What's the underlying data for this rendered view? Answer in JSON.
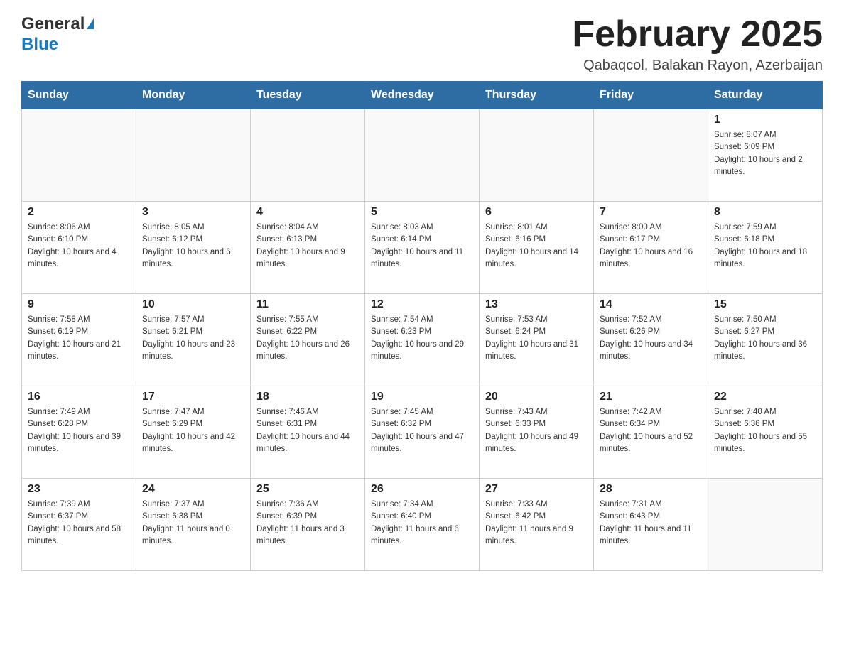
{
  "header": {
    "logo_general": "General",
    "logo_arrow": "▶",
    "logo_blue": "Blue",
    "month_title": "February 2025",
    "location": "Qabaqcol, Balakan Rayon, Azerbaijan"
  },
  "weekdays": [
    "Sunday",
    "Monday",
    "Tuesday",
    "Wednesday",
    "Thursday",
    "Friday",
    "Saturday"
  ],
  "weeks": [
    [
      {
        "day": "",
        "info": ""
      },
      {
        "day": "",
        "info": ""
      },
      {
        "day": "",
        "info": ""
      },
      {
        "day": "",
        "info": ""
      },
      {
        "day": "",
        "info": ""
      },
      {
        "day": "",
        "info": ""
      },
      {
        "day": "1",
        "info": "Sunrise: 8:07 AM\nSunset: 6:09 PM\nDaylight: 10 hours and 2 minutes."
      }
    ],
    [
      {
        "day": "2",
        "info": "Sunrise: 8:06 AM\nSunset: 6:10 PM\nDaylight: 10 hours and 4 minutes."
      },
      {
        "day": "3",
        "info": "Sunrise: 8:05 AM\nSunset: 6:12 PM\nDaylight: 10 hours and 6 minutes."
      },
      {
        "day": "4",
        "info": "Sunrise: 8:04 AM\nSunset: 6:13 PM\nDaylight: 10 hours and 9 minutes."
      },
      {
        "day": "5",
        "info": "Sunrise: 8:03 AM\nSunset: 6:14 PM\nDaylight: 10 hours and 11 minutes."
      },
      {
        "day": "6",
        "info": "Sunrise: 8:01 AM\nSunset: 6:16 PM\nDaylight: 10 hours and 14 minutes."
      },
      {
        "day": "7",
        "info": "Sunrise: 8:00 AM\nSunset: 6:17 PM\nDaylight: 10 hours and 16 minutes."
      },
      {
        "day": "8",
        "info": "Sunrise: 7:59 AM\nSunset: 6:18 PM\nDaylight: 10 hours and 18 minutes."
      }
    ],
    [
      {
        "day": "9",
        "info": "Sunrise: 7:58 AM\nSunset: 6:19 PM\nDaylight: 10 hours and 21 minutes."
      },
      {
        "day": "10",
        "info": "Sunrise: 7:57 AM\nSunset: 6:21 PM\nDaylight: 10 hours and 23 minutes."
      },
      {
        "day": "11",
        "info": "Sunrise: 7:55 AM\nSunset: 6:22 PM\nDaylight: 10 hours and 26 minutes."
      },
      {
        "day": "12",
        "info": "Sunrise: 7:54 AM\nSunset: 6:23 PM\nDaylight: 10 hours and 29 minutes."
      },
      {
        "day": "13",
        "info": "Sunrise: 7:53 AM\nSunset: 6:24 PM\nDaylight: 10 hours and 31 minutes."
      },
      {
        "day": "14",
        "info": "Sunrise: 7:52 AM\nSunset: 6:26 PM\nDaylight: 10 hours and 34 minutes."
      },
      {
        "day": "15",
        "info": "Sunrise: 7:50 AM\nSunset: 6:27 PM\nDaylight: 10 hours and 36 minutes."
      }
    ],
    [
      {
        "day": "16",
        "info": "Sunrise: 7:49 AM\nSunset: 6:28 PM\nDaylight: 10 hours and 39 minutes."
      },
      {
        "day": "17",
        "info": "Sunrise: 7:47 AM\nSunset: 6:29 PM\nDaylight: 10 hours and 42 minutes."
      },
      {
        "day": "18",
        "info": "Sunrise: 7:46 AM\nSunset: 6:31 PM\nDaylight: 10 hours and 44 minutes."
      },
      {
        "day": "19",
        "info": "Sunrise: 7:45 AM\nSunset: 6:32 PM\nDaylight: 10 hours and 47 minutes."
      },
      {
        "day": "20",
        "info": "Sunrise: 7:43 AM\nSunset: 6:33 PM\nDaylight: 10 hours and 49 minutes."
      },
      {
        "day": "21",
        "info": "Sunrise: 7:42 AM\nSunset: 6:34 PM\nDaylight: 10 hours and 52 minutes."
      },
      {
        "day": "22",
        "info": "Sunrise: 7:40 AM\nSunset: 6:36 PM\nDaylight: 10 hours and 55 minutes."
      }
    ],
    [
      {
        "day": "23",
        "info": "Sunrise: 7:39 AM\nSunset: 6:37 PM\nDaylight: 10 hours and 58 minutes."
      },
      {
        "day": "24",
        "info": "Sunrise: 7:37 AM\nSunset: 6:38 PM\nDaylight: 11 hours and 0 minutes."
      },
      {
        "day": "25",
        "info": "Sunrise: 7:36 AM\nSunset: 6:39 PM\nDaylight: 11 hours and 3 minutes."
      },
      {
        "day": "26",
        "info": "Sunrise: 7:34 AM\nSunset: 6:40 PM\nDaylight: 11 hours and 6 minutes."
      },
      {
        "day": "27",
        "info": "Sunrise: 7:33 AM\nSunset: 6:42 PM\nDaylight: 11 hours and 9 minutes."
      },
      {
        "day": "28",
        "info": "Sunrise: 7:31 AM\nSunset: 6:43 PM\nDaylight: 11 hours and 11 minutes."
      },
      {
        "day": "",
        "info": ""
      }
    ]
  ]
}
